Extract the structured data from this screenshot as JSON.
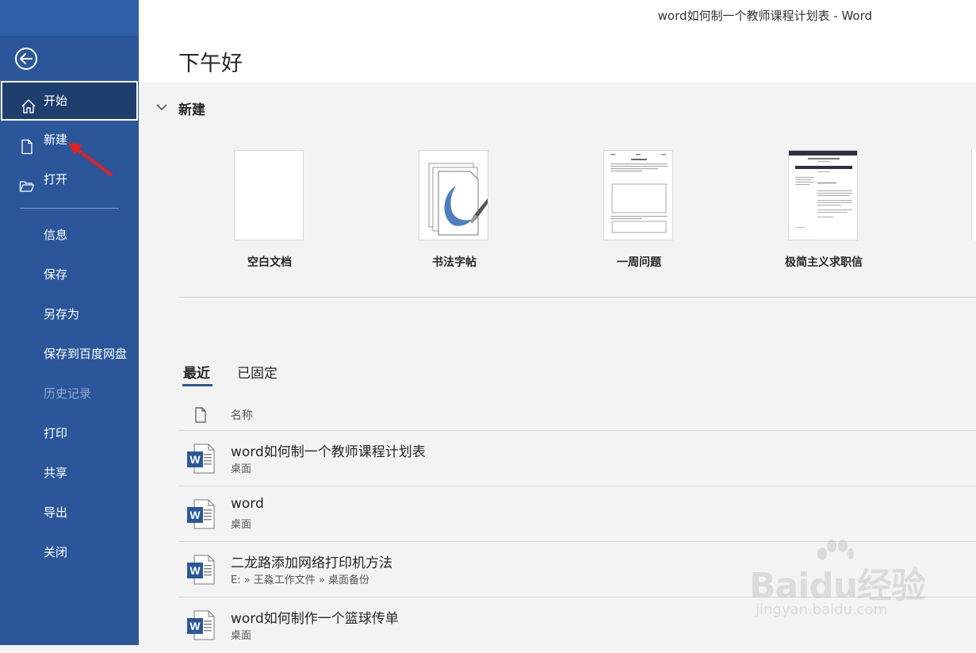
{
  "window": {
    "title": "word如何制一个教师课程计划表  -  Word"
  },
  "header": {
    "greeting": "下午好"
  },
  "sidebar": {
    "items": [
      {
        "label": "开始",
        "icon": "home-icon"
      },
      {
        "label": "新建",
        "icon": "new-document-icon"
      },
      {
        "label": "打开",
        "icon": "open-folder-icon"
      },
      {
        "label": "信息"
      },
      {
        "label": "保存"
      },
      {
        "label": "另存为"
      },
      {
        "label": "保存到百度网盘"
      },
      {
        "label": "历史记录"
      },
      {
        "label": "打印"
      },
      {
        "label": "共享"
      },
      {
        "label": "导出"
      },
      {
        "label": "关闭"
      }
    ],
    "active": "开始",
    "disabled": "历史记录",
    "accent": "#2b579a"
  },
  "new_section": {
    "title": "新建",
    "templates": [
      {
        "name": "空白文档"
      },
      {
        "name": "书法字帖"
      },
      {
        "name": "一周问题"
      },
      {
        "name": "极简主义求职信"
      }
    ]
  },
  "recent": {
    "tabs": [
      {
        "label": "最近"
      },
      {
        "label": "已固定"
      }
    ],
    "active_tab": "最近",
    "column_header": "名称",
    "files": [
      {
        "name": "word如何制一个教师课程计划表",
        "path": "桌面"
      },
      {
        "name": "word",
        "path": "桌面"
      },
      {
        "name": "二龙路添加网络打印机方法",
        "path": "E: » 王淼工作文件 » 桌面备份"
      },
      {
        "name": "word如何制作一个篮球传单",
        "path": "桌面"
      }
    ]
  },
  "watermark": {
    "main": "Baidu经验",
    "sub": "jingyan.baidu.com"
  }
}
